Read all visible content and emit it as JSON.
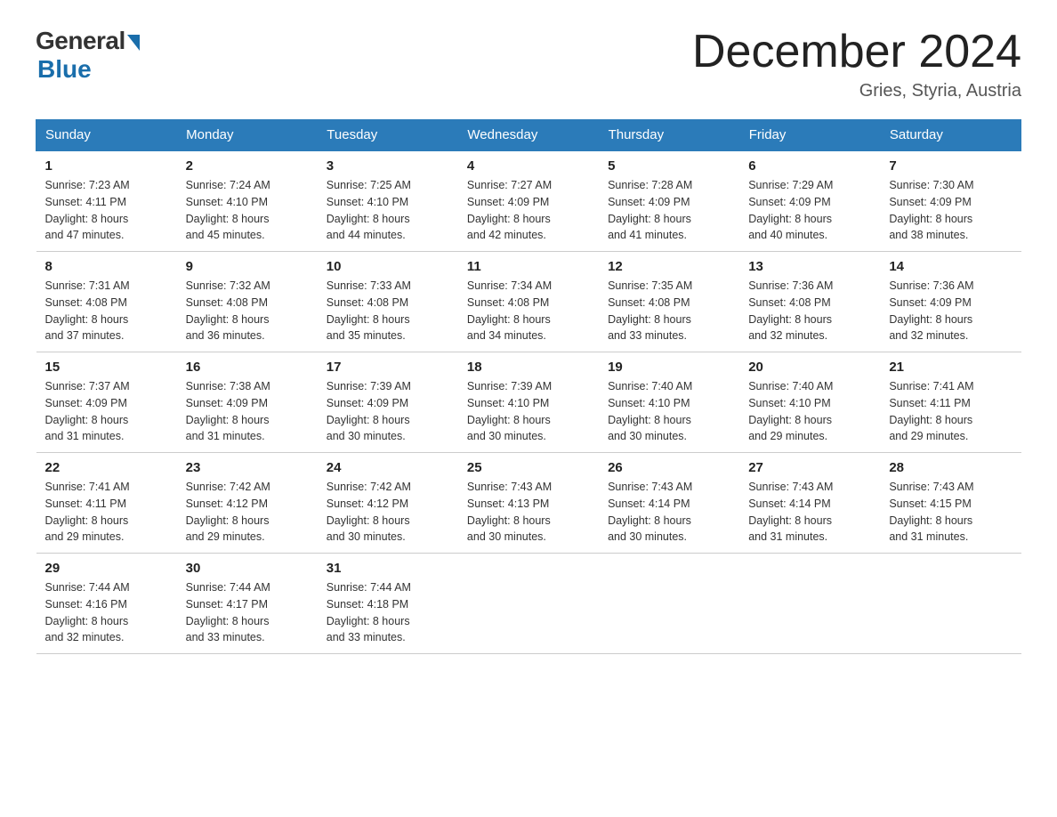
{
  "header": {
    "logo_general": "General",
    "logo_blue": "Blue",
    "title": "December 2024",
    "subtitle": "Gries, Styria, Austria"
  },
  "columns": [
    "Sunday",
    "Monday",
    "Tuesday",
    "Wednesday",
    "Thursday",
    "Friday",
    "Saturday"
  ],
  "weeks": [
    [
      {
        "day": "1",
        "info": "Sunrise: 7:23 AM\nSunset: 4:11 PM\nDaylight: 8 hours\nand 47 minutes."
      },
      {
        "day": "2",
        "info": "Sunrise: 7:24 AM\nSunset: 4:10 PM\nDaylight: 8 hours\nand 45 minutes."
      },
      {
        "day": "3",
        "info": "Sunrise: 7:25 AM\nSunset: 4:10 PM\nDaylight: 8 hours\nand 44 minutes."
      },
      {
        "day": "4",
        "info": "Sunrise: 7:27 AM\nSunset: 4:09 PM\nDaylight: 8 hours\nand 42 minutes."
      },
      {
        "day": "5",
        "info": "Sunrise: 7:28 AM\nSunset: 4:09 PM\nDaylight: 8 hours\nand 41 minutes."
      },
      {
        "day": "6",
        "info": "Sunrise: 7:29 AM\nSunset: 4:09 PM\nDaylight: 8 hours\nand 40 minutes."
      },
      {
        "day": "7",
        "info": "Sunrise: 7:30 AM\nSunset: 4:09 PM\nDaylight: 8 hours\nand 38 minutes."
      }
    ],
    [
      {
        "day": "8",
        "info": "Sunrise: 7:31 AM\nSunset: 4:08 PM\nDaylight: 8 hours\nand 37 minutes."
      },
      {
        "day": "9",
        "info": "Sunrise: 7:32 AM\nSunset: 4:08 PM\nDaylight: 8 hours\nand 36 minutes."
      },
      {
        "day": "10",
        "info": "Sunrise: 7:33 AM\nSunset: 4:08 PM\nDaylight: 8 hours\nand 35 minutes."
      },
      {
        "day": "11",
        "info": "Sunrise: 7:34 AM\nSunset: 4:08 PM\nDaylight: 8 hours\nand 34 minutes."
      },
      {
        "day": "12",
        "info": "Sunrise: 7:35 AM\nSunset: 4:08 PM\nDaylight: 8 hours\nand 33 minutes."
      },
      {
        "day": "13",
        "info": "Sunrise: 7:36 AM\nSunset: 4:08 PM\nDaylight: 8 hours\nand 32 minutes."
      },
      {
        "day": "14",
        "info": "Sunrise: 7:36 AM\nSunset: 4:09 PM\nDaylight: 8 hours\nand 32 minutes."
      }
    ],
    [
      {
        "day": "15",
        "info": "Sunrise: 7:37 AM\nSunset: 4:09 PM\nDaylight: 8 hours\nand 31 minutes."
      },
      {
        "day": "16",
        "info": "Sunrise: 7:38 AM\nSunset: 4:09 PM\nDaylight: 8 hours\nand 31 minutes."
      },
      {
        "day": "17",
        "info": "Sunrise: 7:39 AM\nSunset: 4:09 PM\nDaylight: 8 hours\nand 30 minutes."
      },
      {
        "day": "18",
        "info": "Sunrise: 7:39 AM\nSunset: 4:10 PM\nDaylight: 8 hours\nand 30 minutes."
      },
      {
        "day": "19",
        "info": "Sunrise: 7:40 AM\nSunset: 4:10 PM\nDaylight: 8 hours\nand 30 minutes."
      },
      {
        "day": "20",
        "info": "Sunrise: 7:40 AM\nSunset: 4:10 PM\nDaylight: 8 hours\nand 29 minutes."
      },
      {
        "day": "21",
        "info": "Sunrise: 7:41 AM\nSunset: 4:11 PM\nDaylight: 8 hours\nand 29 minutes."
      }
    ],
    [
      {
        "day": "22",
        "info": "Sunrise: 7:41 AM\nSunset: 4:11 PM\nDaylight: 8 hours\nand 29 minutes."
      },
      {
        "day": "23",
        "info": "Sunrise: 7:42 AM\nSunset: 4:12 PM\nDaylight: 8 hours\nand 29 minutes."
      },
      {
        "day": "24",
        "info": "Sunrise: 7:42 AM\nSunset: 4:12 PM\nDaylight: 8 hours\nand 30 minutes."
      },
      {
        "day": "25",
        "info": "Sunrise: 7:43 AM\nSunset: 4:13 PM\nDaylight: 8 hours\nand 30 minutes."
      },
      {
        "day": "26",
        "info": "Sunrise: 7:43 AM\nSunset: 4:14 PM\nDaylight: 8 hours\nand 30 minutes."
      },
      {
        "day": "27",
        "info": "Sunrise: 7:43 AM\nSunset: 4:14 PM\nDaylight: 8 hours\nand 31 minutes."
      },
      {
        "day": "28",
        "info": "Sunrise: 7:43 AM\nSunset: 4:15 PM\nDaylight: 8 hours\nand 31 minutes."
      }
    ],
    [
      {
        "day": "29",
        "info": "Sunrise: 7:44 AM\nSunset: 4:16 PM\nDaylight: 8 hours\nand 32 minutes."
      },
      {
        "day": "30",
        "info": "Sunrise: 7:44 AM\nSunset: 4:17 PM\nDaylight: 8 hours\nand 33 minutes."
      },
      {
        "day": "31",
        "info": "Sunrise: 7:44 AM\nSunset: 4:18 PM\nDaylight: 8 hours\nand 33 minutes."
      },
      {
        "day": "",
        "info": ""
      },
      {
        "day": "",
        "info": ""
      },
      {
        "day": "",
        "info": ""
      },
      {
        "day": "",
        "info": ""
      }
    ]
  ]
}
